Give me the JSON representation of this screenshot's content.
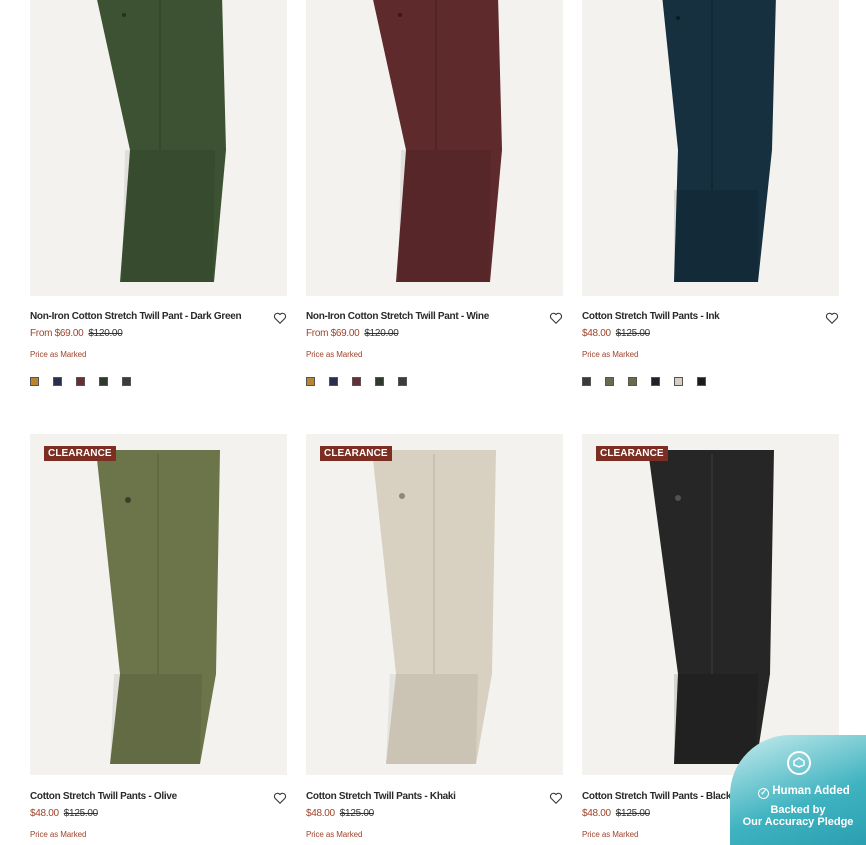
{
  "products": [
    {
      "title": "Non-Iron Cotton Stretch Twill Pant - Dark Green",
      "price_now": "From $69.00",
      "price_was": "$120.00",
      "note": "Price as Marked",
      "badge": "",
      "pant_color": "#3c5232",
      "swatches": [
        "#b8862e",
        "#2b2f4e",
        "#6a2d32",
        "#2f3a2f",
        "#3c3c3c"
      ]
    },
    {
      "title": "Non-Iron Cotton Stretch Twill Pant - Wine",
      "price_now": "From $69.00",
      "price_was": "$120.00",
      "note": "Price as Marked",
      "badge": "",
      "pant_color": "#5e2a2c",
      "swatches": [
        "#b8862e",
        "#2b2f4e",
        "#6a2d32",
        "#2f3a2f",
        "#3c3c3c"
      ]
    },
    {
      "title": "Cotton Stretch Twill Pants - Ink",
      "price_now": "$48.00",
      "price_was": "$125.00",
      "note": "Price as Marked",
      "badge": "",
      "pant_color": "#16303f",
      "swatches": [
        "#3a3a3a",
        "#6a6a52",
        "#6b6b48",
        "#1f2228",
        "#d6cfc0",
        "#1b1b1b"
      ]
    },
    {
      "title": "Cotton Stretch Twill Pants - Olive",
      "price_now": "$48.00",
      "price_was": "$125.00",
      "note": "Price as Marked",
      "badge": "CLEARANCE",
      "pant_color": "#6b7549"
    },
    {
      "title": "Cotton Stretch Twill Pants - Khaki",
      "price_now": "$48.00",
      "price_was": "$125.00",
      "note": "Price as Marked",
      "badge": "CLEARANCE",
      "pant_color": "#d8d1c1"
    },
    {
      "title": "Cotton Stretch Twill Pants - Black",
      "price_now": "$48.00",
      "price_was": "$125.00",
      "note": "Price as Marked",
      "badge": "CLEARANCE",
      "pant_color": "#262626"
    }
  ],
  "pledge": {
    "human_added": "Human Added",
    "backed_by": "Backed by",
    "pledge_text": "Our Accuracy Pledge"
  }
}
